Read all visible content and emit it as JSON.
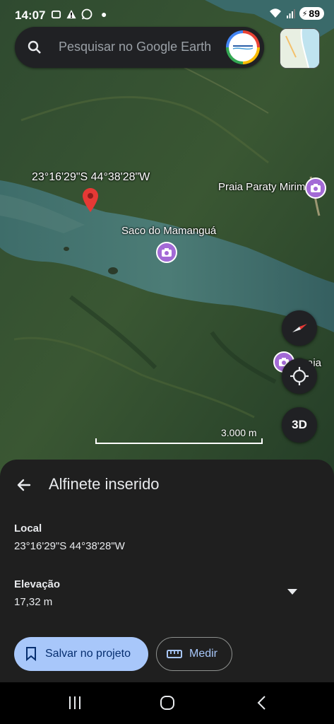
{
  "status_bar": {
    "time": "14:07",
    "battery": "89",
    "icons": [
      "screenshot-icon",
      "alert-icon",
      "whatsapp-icon",
      "dot-icon",
      "wifi-icon",
      "signal-icon",
      "battery-icon"
    ]
  },
  "search": {
    "placeholder": "Pesquisar no Google Earth"
  },
  "map": {
    "pin_coordinates": "23°16'29\"S 44°38'28\"W",
    "places": [
      {
        "name": "Praia Paraty Mirim"
      },
      {
        "name": "Saco do Mamanguá"
      },
      {
        "name": "Praia do"
      }
    ],
    "scale_label": "3.000 m",
    "three_d_label": "3D"
  },
  "sheet": {
    "title": "Alfinete inserido",
    "location_label": "Local",
    "location_value": "23°16'29\"S 44°38'28\"W",
    "elevation_label": "Elevação",
    "elevation_value": "17,32 m",
    "save_button": "Salvar no projeto",
    "measure_button": "Medir"
  },
  "colors": {
    "sheet_bg": "#1f1f1f",
    "primary_button": "#a8c7fa",
    "poi": "#a36ad6",
    "pin": "#e53935"
  }
}
